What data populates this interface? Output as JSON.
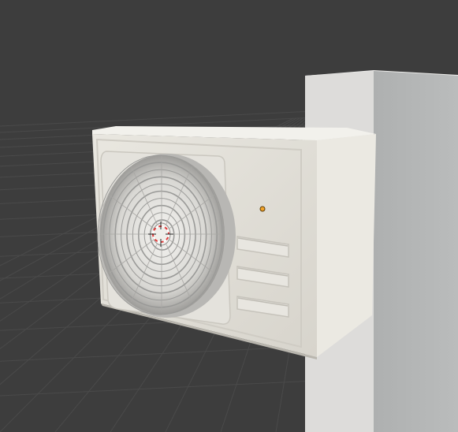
{
  "viewport": {
    "kind": "3d-viewport",
    "background_color": "#3d3d3d",
    "grid_color": "#4a4a4a",
    "floor_color": "#3a3a3a"
  },
  "scene": {
    "wall_pillar": {
      "color_front": "#dddcda",
      "color_side": "#b4b6b6",
      "color_top": "#ececea"
    },
    "ac_unit": {
      "body_color": "#e2e0d9",
      "side_color": "#ebe9e2",
      "top_color": "#f2f1ec",
      "shadow_color": "#c9c6bd",
      "fan_grille_color": "#cfcfcd",
      "fan_ring_color": "#9a9a98",
      "vents_count": 3,
      "fan_rings": 10
    },
    "object_origin": {
      "color": "#f2a32a"
    },
    "cursor_3d": {
      "color_a": "#e23b3b",
      "color_b": "#ffffff"
    }
  }
}
